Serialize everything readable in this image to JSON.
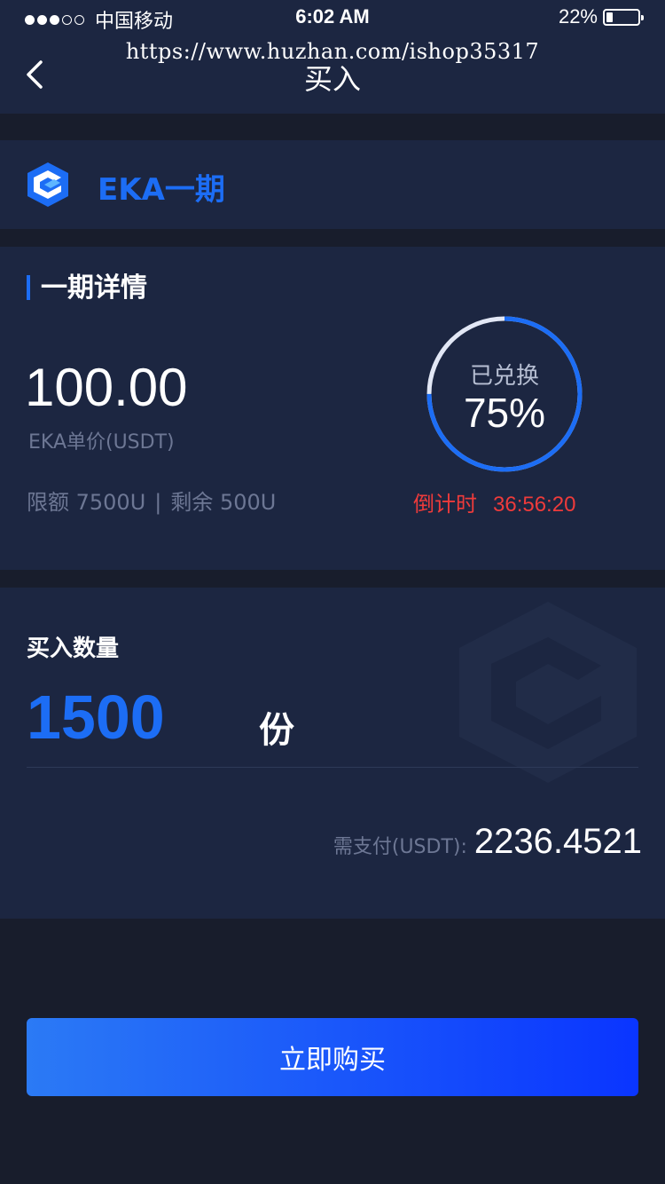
{
  "status_bar": {
    "carrier": "中国移动",
    "time": "6:02 AM",
    "battery": "22%",
    "battery_level": 0.22
  },
  "watermark": "https://www.huzhan.com/ishop35317",
  "header": {
    "title": "买入"
  },
  "product": {
    "name": "EKA一期",
    "brand_color": "#1c6df5"
  },
  "details": {
    "title": "一期详情",
    "price": "100.00",
    "price_label": "EKA单价(USDT)",
    "limit": "限额 7500U",
    "separator": "|",
    "remaining": "剩余 500U",
    "progress_label": "已兑换",
    "progress_text": "75%",
    "progress": 0.75,
    "countdown_label": "倒计时",
    "countdown_time": "36:56:20",
    "countdown_color": "#ee3b3b"
  },
  "buy": {
    "quantity_label": "买入数量",
    "quantity": "1500",
    "unit": "份",
    "pay_label": "需支付(USDT):",
    "pay_value": "2236.4521"
  },
  "button": {
    "label": "立即购买"
  }
}
